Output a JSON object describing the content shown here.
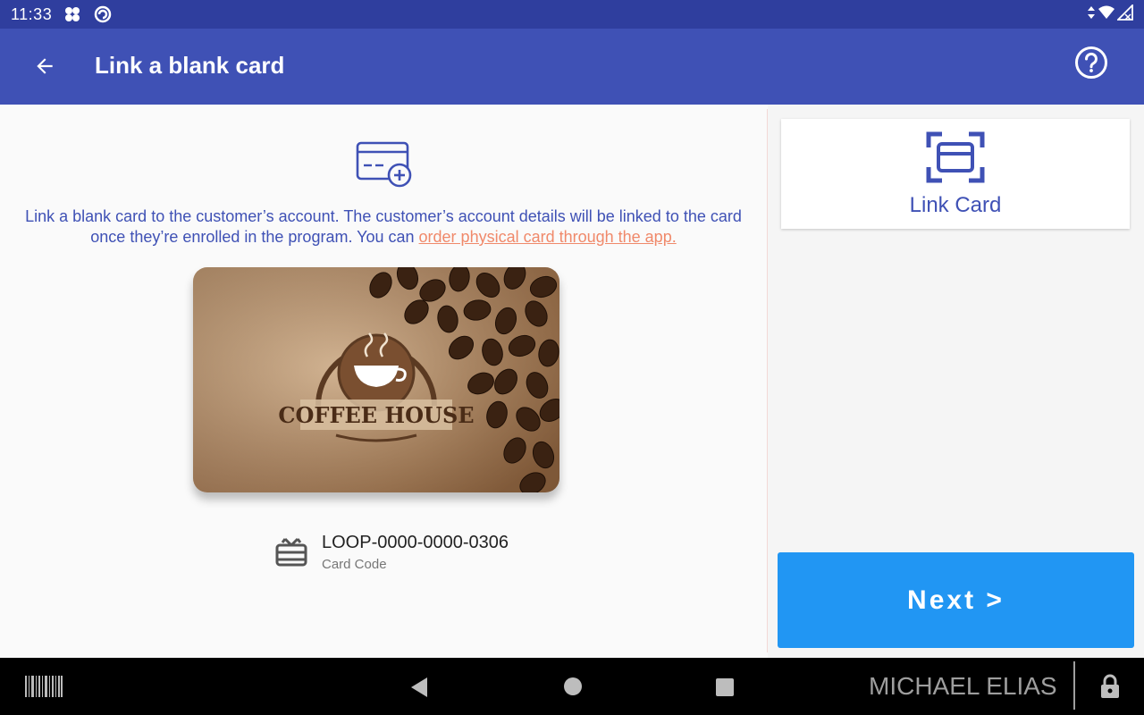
{
  "status_bar": {
    "time": "11:33",
    "icons": [
      "app-icon",
      "sync-icon"
    ],
    "right_icons": [
      "data-arrows-icon",
      "wifi-icon",
      "signal-icon"
    ]
  },
  "app_bar": {
    "title": "Link a blank card",
    "back_icon": "back-arrow-icon",
    "help_icon": "help-icon"
  },
  "main": {
    "description_text": "Link a blank card to the customer’s account. The customer’s account details will be linked to the card once they’re enrolled in the program. You can ",
    "description_link": "order physical card through the app.",
    "card_image_alt": "COFFEE HOUSE",
    "card_code": "LOOP-0000-0000-0306",
    "card_code_label": "Card Code"
  },
  "side_panel": {
    "link_card_label": "Link Card",
    "next_label": "Next >"
  },
  "nav_bar": {
    "user_name": "MICHAEL ELIAS"
  },
  "colors": {
    "status_bar": "#2f3e9e",
    "app_bar": "#3f51b5",
    "primary_text": "#3f51b5",
    "link": "#f0896a",
    "next_button": "#2196f3"
  }
}
